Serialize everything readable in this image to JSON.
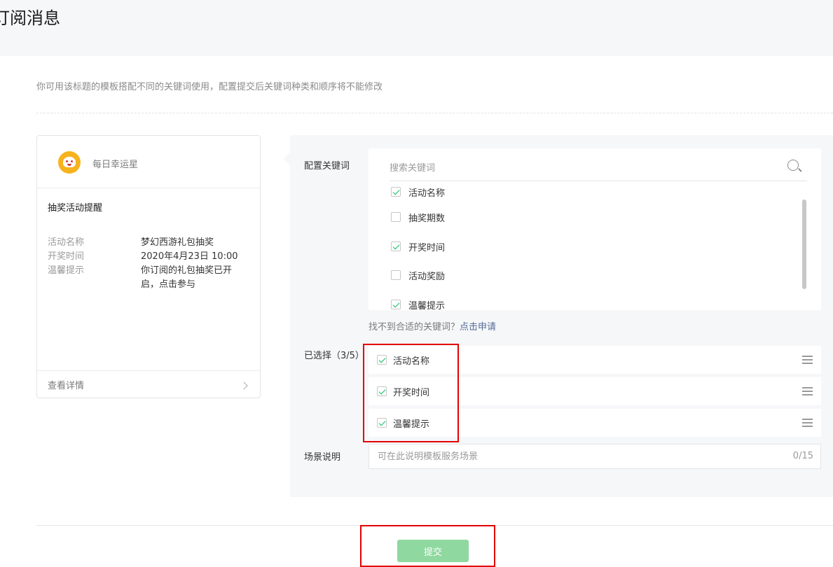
{
  "header": {
    "title": "订阅消息"
  },
  "tip": "你可用该标题的模板搭配不同的关键词使用，配置提交后关键词种类和顺序将不能修改",
  "preview": {
    "account_name": "每日幸运星",
    "card_title": "抽奖活动提醒",
    "fields": [
      {
        "key": "活动名称",
        "value": "梦幻西游礼包抽奖"
      },
      {
        "key": "开奖时间",
        "value": "2020年4月23日 10:00"
      },
      {
        "key": "温馨提示",
        "value": "你订阅的礼包抽奖已开启，点击参与"
      }
    ],
    "detail_label": "查看详情"
  },
  "config": {
    "keywords_label": "配置关键词",
    "search_placeholder": "搜索关键词",
    "keywords": [
      {
        "label": "活动名称",
        "checked": true
      },
      {
        "label": "抽奖期数",
        "checked": false
      },
      {
        "label": "开奖时间",
        "checked": true
      },
      {
        "label": "活动奖励",
        "checked": false
      },
      {
        "label": "温馨提示",
        "checked": true
      }
    ],
    "not_found_text": "找不到合适的关键词？",
    "apply_link": "点击申请",
    "selected_label": "已选择（3/5）",
    "selected": [
      {
        "label": "活动名称",
        "checked": true
      },
      {
        "label": "开奖时间",
        "checked": true
      },
      {
        "label": "温馨提示",
        "checked": true
      }
    ],
    "scene_label": "场景说明",
    "scene_placeholder": "可在此说明模板服务场景",
    "scene_count": "0/15"
  },
  "submit_label": "提交",
  "colors": {
    "accent": "#07c160",
    "link": "#576b95",
    "highlight": "#e30000",
    "submit_disabled": "#8fd89f"
  }
}
